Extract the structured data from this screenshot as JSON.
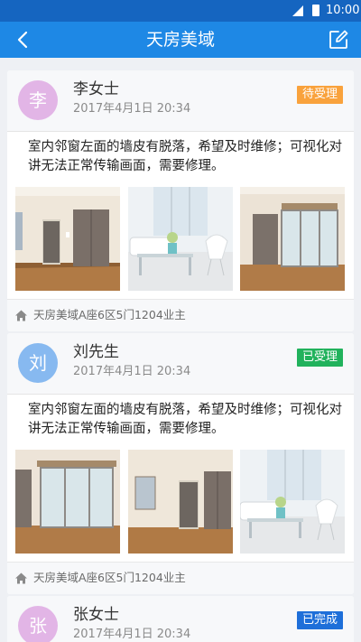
{
  "status_bar": {
    "time": "10:00"
  },
  "header": {
    "title": "天房美域",
    "back_icon": "back-arrow-icon",
    "edit_icon": "edit-icon"
  },
  "colors": {
    "header_bg": "#1e88e5",
    "status_bar_bg": "#1565c0",
    "status_pending": "#f9a23c",
    "status_accepted": "#21b25c",
    "status_done": "#1e6fd9"
  },
  "repairs": [
    {
      "avatar_char": "李",
      "avatar_color": "#e2b5e6",
      "name": "李女士",
      "time": "2017年4月1日 20:34",
      "status": "待受理",
      "status_color": "#f9a23c",
      "description": "室内邻窗左面的墙皮有脱落，希望及时维修；可视化对讲无法正常传输画面，需要修理。",
      "address": "天房美域A座6区5门1204业主"
    },
    {
      "avatar_char": "刘",
      "avatar_color": "#87b9f0",
      "name": "刘先生",
      "time": "2017年4月1日 20:34",
      "status": "已受理",
      "status_color": "#21b25c",
      "description": "室内邻窗左面的墙皮有脱落，希望及时维修；可视化对讲无法正常传输画面，需要修理。",
      "address": "天房美域A座6区5门1204业主"
    },
    {
      "avatar_char": "张",
      "avatar_color": "#e2b5e6",
      "name": "张女士",
      "time": "2017年4月1日 20:34",
      "status": "已完成",
      "status_color": "#1e6fd9"
    }
  ]
}
